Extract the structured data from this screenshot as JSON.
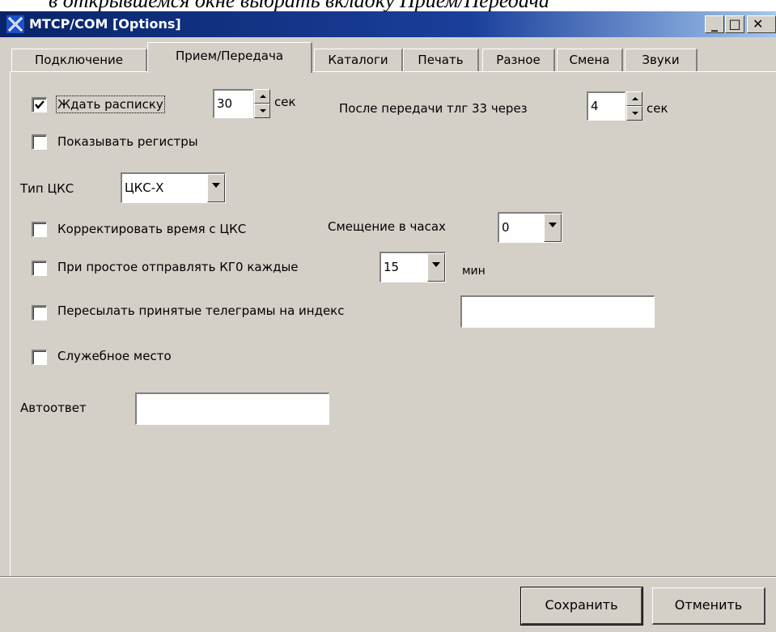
{
  "above_text": "в открывшемся окне выбрать вкладку Прием/Передача",
  "window": {
    "title": "MTCP/COM [Options]",
    "icon": "x-app-icon",
    "controls": {
      "minimize": "_",
      "maximize": "□",
      "close": "✕"
    }
  },
  "tabs": [
    {
      "label": "Подключение",
      "active": false
    },
    {
      "label": "Прием/Передача",
      "active": true
    },
    {
      "label": "Каталоги",
      "active": false
    },
    {
      "label": "Печать",
      "active": false
    },
    {
      "label": "Разное",
      "active": false
    },
    {
      "label": "Смена",
      "active": false
    },
    {
      "label": "Звуки",
      "active": false
    }
  ],
  "form": {
    "wait_receipt": {
      "label": "Ждать расписку",
      "checked": true,
      "value": "30",
      "unit": "сек"
    },
    "after_send": {
      "label": "После передачи тлг 33 через",
      "value": "4",
      "unit": "сек"
    },
    "show_registers": {
      "label": "Показывать регистры",
      "checked": false
    },
    "cks_type": {
      "label": "Тип ЦКС",
      "value": "ЦКС-Х"
    },
    "correct_time": {
      "label": "Корректировать время с ЦКС",
      "checked": false
    },
    "offset_hours": {
      "label": "Смещение в часах",
      "value": "0"
    },
    "idle_send": {
      "label": "При простое отправлять КГ0 каждые",
      "checked": false,
      "value": "15",
      "unit": "мин"
    },
    "forward": {
      "label": "Пересылать принятые телеграмы на индекс",
      "checked": false,
      "value": ""
    },
    "service_place": {
      "label": "Служебное место",
      "checked": false
    },
    "autoreply": {
      "label": "Автоответ",
      "value": ""
    }
  },
  "buttons": {
    "save": "Сохранить",
    "cancel": "Отменить"
  }
}
